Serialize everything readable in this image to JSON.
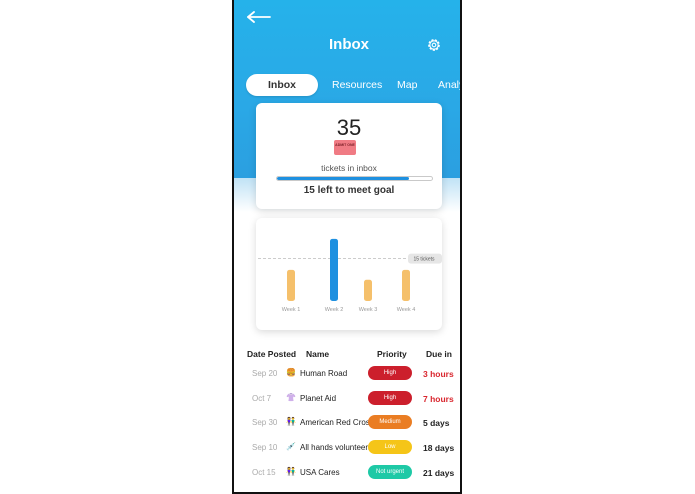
{
  "header": {
    "title": "Inbox"
  },
  "tabs": [
    {
      "label": "Inbox",
      "active": true
    },
    {
      "label": "Resources",
      "active": false
    },
    {
      "label": "Map",
      "active": false
    },
    {
      "label": "Analy",
      "active": false
    }
  ],
  "summary": {
    "count": "35",
    "ticket_text": "ADMIT ONE",
    "label": "tickets in inbox",
    "progress": 0.85,
    "goal_text": "15 left to meet goal"
  },
  "chart_data": {
    "type": "bar",
    "categories": [
      "Week 1",
      "Week 2",
      "Week 3",
      "Week 4"
    ],
    "values": [
      11,
      22,
      7.5,
      11
    ],
    "highlight_index": 1,
    "ylim": [
      0,
      23
    ],
    "reference_line": {
      "value": 15,
      "label": "15 tickets"
    },
    "colors": {
      "default": "#f5c06b",
      "highlight": "#1e90e0",
      "reference": "#bbbbbb"
    }
  },
  "table": {
    "headers": {
      "date": "Date Posted",
      "name": "Name",
      "priority": "Priority",
      "due": "Due in"
    },
    "rows": [
      {
        "date": "Sep 20",
        "icon": "burger-icon",
        "icon_glyph": "🍔",
        "name": "Human Road",
        "priority": "High",
        "priority_color": "#cc1f2c",
        "due": "3 hours",
        "due_color": "#d9262e"
      },
      {
        "date": "Oct 7",
        "icon": "shirt-icon",
        "icon_glyph": "👚",
        "name": "Planet Aid",
        "priority": "High",
        "priority_color": "#cc1f2c",
        "due": "7 hours",
        "due_color": "#d9262e"
      },
      {
        "date": "Sep 30",
        "icon": "people-icon",
        "icon_glyph": "👫",
        "name": "American Red Cross",
        "priority": "Medium",
        "priority_color": "#ea7d23",
        "due": "5 days",
        "due_color": "#222222"
      },
      {
        "date": "Sep 10",
        "icon": "syringe-icon",
        "icon_glyph": "💉",
        "name": "All hands volunteers",
        "priority": "Low",
        "priority_color": "#f5c518",
        "due": "18 days",
        "due_color": "#222222"
      },
      {
        "date": "Oct 15",
        "icon": "people-icon",
        "icon_glyph": "👫",
        "name": "USA Cares",
        "priority": "Not urgent",
        "priority_color": "#1ec9a6",
        "due": "21 days",
        "due_color": "#222222"
      }
    ]
  }
}
